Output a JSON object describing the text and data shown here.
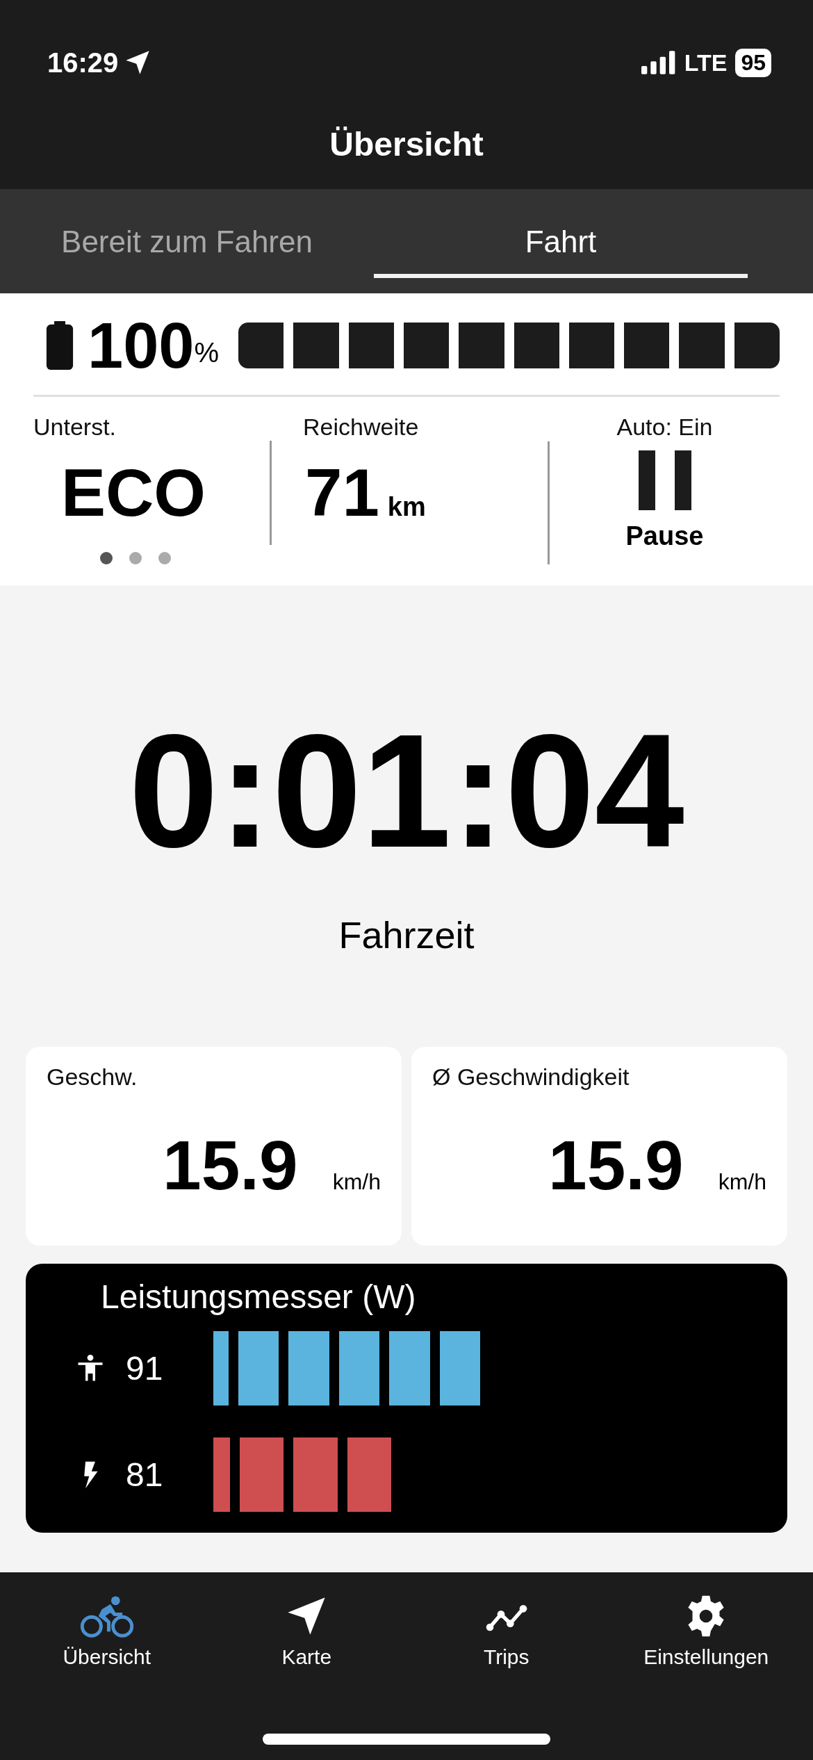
{
  "status_bar": {
    "time": "16:29",
    "network": "LTE",
    "battery": "95"
  },
  "header": {
    "title": "Übersicht"
  },
  "tabs": [
    {
      "label": "Bereit zum Fahren",
      "selected": false
    },
    {
      "label": "Fahrt",
      "selected": true
    }
  ],
  "battery": {
    "value": "100",
    "unit": "%",
    "level": 1
  },
  "stats": [
    {
      "kind": "mode",
      "label": "Unterst.",
      "value": "ECO"
    },
    {
      "kind": "range",
      "label": "Reichweite",
      "value": "71",
      "unit": "km"
    },
    {
      "kind": "pause",
      "label": "Auto: Ein",
      "value": "Pause"
    }
  ],
  "page_dots": [
    {
      "selected": true
    },
    {
      "selected": false
    },
    {
      "selected": false
    }
  ],
  "timer": {
    "value": "0:01:04",
    "label": "Fahrzeit"
  },
  "cards": [
    {
      "label": "Geschw.",
      "value": "15.9",
      "unit": "km/h"
    },
    {
      "label": "Ø Geschwindigkeit",
      "value": "15.9",
      "unit": "km/h"
    }
  ],
  "power_meter": {
    "title": "Leistungsmesser (W)",
    "rows": [
      {
        "kind": "rider",
        "value": "91",
        "color": "#5ab4dd"
      },
      {
        "kind": "motor",
        "value": "81",
        "color": "#cf4e50"
      }
    ]
  },
  "nav": [
    {
      "kind": "bike",
      "label": "Übersicht",
      "selected": true
    },
    {
      "kind": "map",
      "label": "Karte",
      "selected": false
    },
    {
      "kind": "trips",
      "label": "Trips",
      "selected": false
    },
    {
      "kind": "settings",
      "label": "Einstellungen",
      "selected": false
    }
  ]
}
